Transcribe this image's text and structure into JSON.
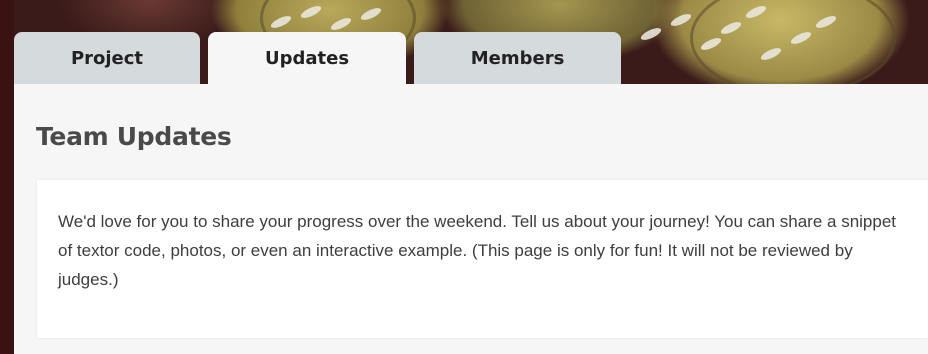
{
  "tabs": [
    {
      "label": "Project",
      "active": false
    },
    {
      "label": "Updates",
      "active": true
    },
    {
      "label": "Members",
      "active": false
    }
  ],
  "section": {
    "title": "Team Updates",
    "description": "We'd love for you to share your progress over the weekend. Tell us about your journey! You can share a snippet of textor code, photos, or even an interactive example. (This page is only for fun! It will not be reviewed by judges.)"
  },
  "colors": {
    "active_tab": "#f6f6f6",
    "inactive_tab": "#d5dadd",
    "panel_background": "#f6f6f6",
    "card_background": "#ffffff",
    "title_text": "#4a4a4a",
    "body_text": "#3e3e3e"
  }
}
